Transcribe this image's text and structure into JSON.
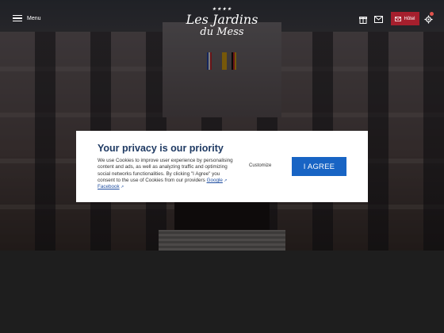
{
  "header": {
    "menu_label": "Menu",
    "logo_stars": "★★★★",
    "logo_line1": "Les Jardins",
    "logo_line2": "du Mess",
    "book_label": "Hôtel"
  },
  "icons": {
    "menu": "hamburger-icon",
    "gift": "gift-icon",
    "mail": "mail-icon",
    "book": "mail-icon",
    "settings": "gear-icon"
  },
  "cookie_banner": {
    "title": "Your privacy is our priority",
    "body": "We use Cookies to improve user experience by personalising content and ads, as well as analyzing traffic and optimizing social networks functionalities. By clicking \"I Agree\" you consent to the use of Cookies from our providers",
    "link_google": "Google",
    "link_facebook": "Facebook",
    "customize_label": "Customize",
    "agree_label": "I AGREE"
  },
  "colors": {
    "title": "#1f3a63",
    "agree_button": "#1864c4",
    "book_button": "#a51f2d",
    "page_bg": "#1e1e1e"
  }
}
